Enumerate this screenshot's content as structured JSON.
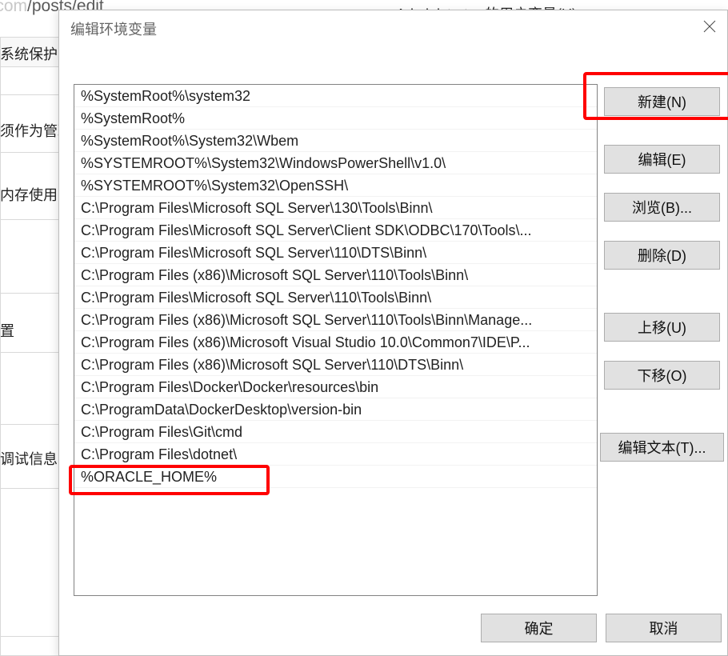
{
  "url": {
    "gray_prefix": "logs.com",
    "dark_part": "/posts/edit"
  },
  "background": {
    "tab_label": "系统保护",
    "left_labels": [
      "须作为管理",
      "内存使用",
      "置",
      "调试信息"
    ],
    "parent_dialog_title": "Administrator 的用户变量(U)"
  },
  "dialog": {
    "title": "编辑环境变量",
    "list_items": [
      "%SystemRoot%\\system32",
      "%SystemRoot%",
      "%SystemRoot%\\System32\\Wbem",
      "%SYSTEMROOT%\\System32\\WindowsPowerShell\\v1.0\\",
      "%SYSTEMROOT%\\System32\\OpenSSH\\",
      "C:\\Program Files\\Microsoft SQL Server\\130\\Tools\\Binn\\",
      "C:\\Program Files\\Microsoft SQL Server\\Client SDK\\ODBC\\170\\Tools\\...",
      "C:\\Program Files\\Microsoft SQL Server\\110\\DTS\\Binn\\",
      "C:\\Program Files (x86)\\Microsoft SQL Server\\110\\Tools\\Binn\\",
      "C:\\Program Files\\Microsoft SQL Server\\110\\Tools\\Binn\\",
      "C:\\Program Files (x86)\\Microsoft SQL Server\\110\\Tools\\Binn\\Manage...",
      "C:\\Program Files (x86)\\Microsoft Visual Studio 10.0\\Common7\\IDE\\P...",
      "C:\\Program Files (x86)\\Microsoft SQL Server\\110\\DTS\\Binn\\",
      "C:\\Program Files\\Docker\\Docker\\resources\\bin",
      "C:\\ProgramData\\DockerDesktop\\version-bin",
      "C:\\Program Files\\Git\\cmd",
      "C:\\Program Files\\dotnet\\",
      "%ORACLE_HOME%"
    ],
    "buttons": {
      "new": "新建(N)",
      "edit": "编辑(E)",
      "browse": "浏览(B)...",
      "delete": "删除(D)",
      "move_up": "上移(U)",
      "move_down": "下移(O)",
      "edit_text": "编辑文本(T)...",
      "ok": "确定",
      "cancel": "取消"
    }
  }
}
